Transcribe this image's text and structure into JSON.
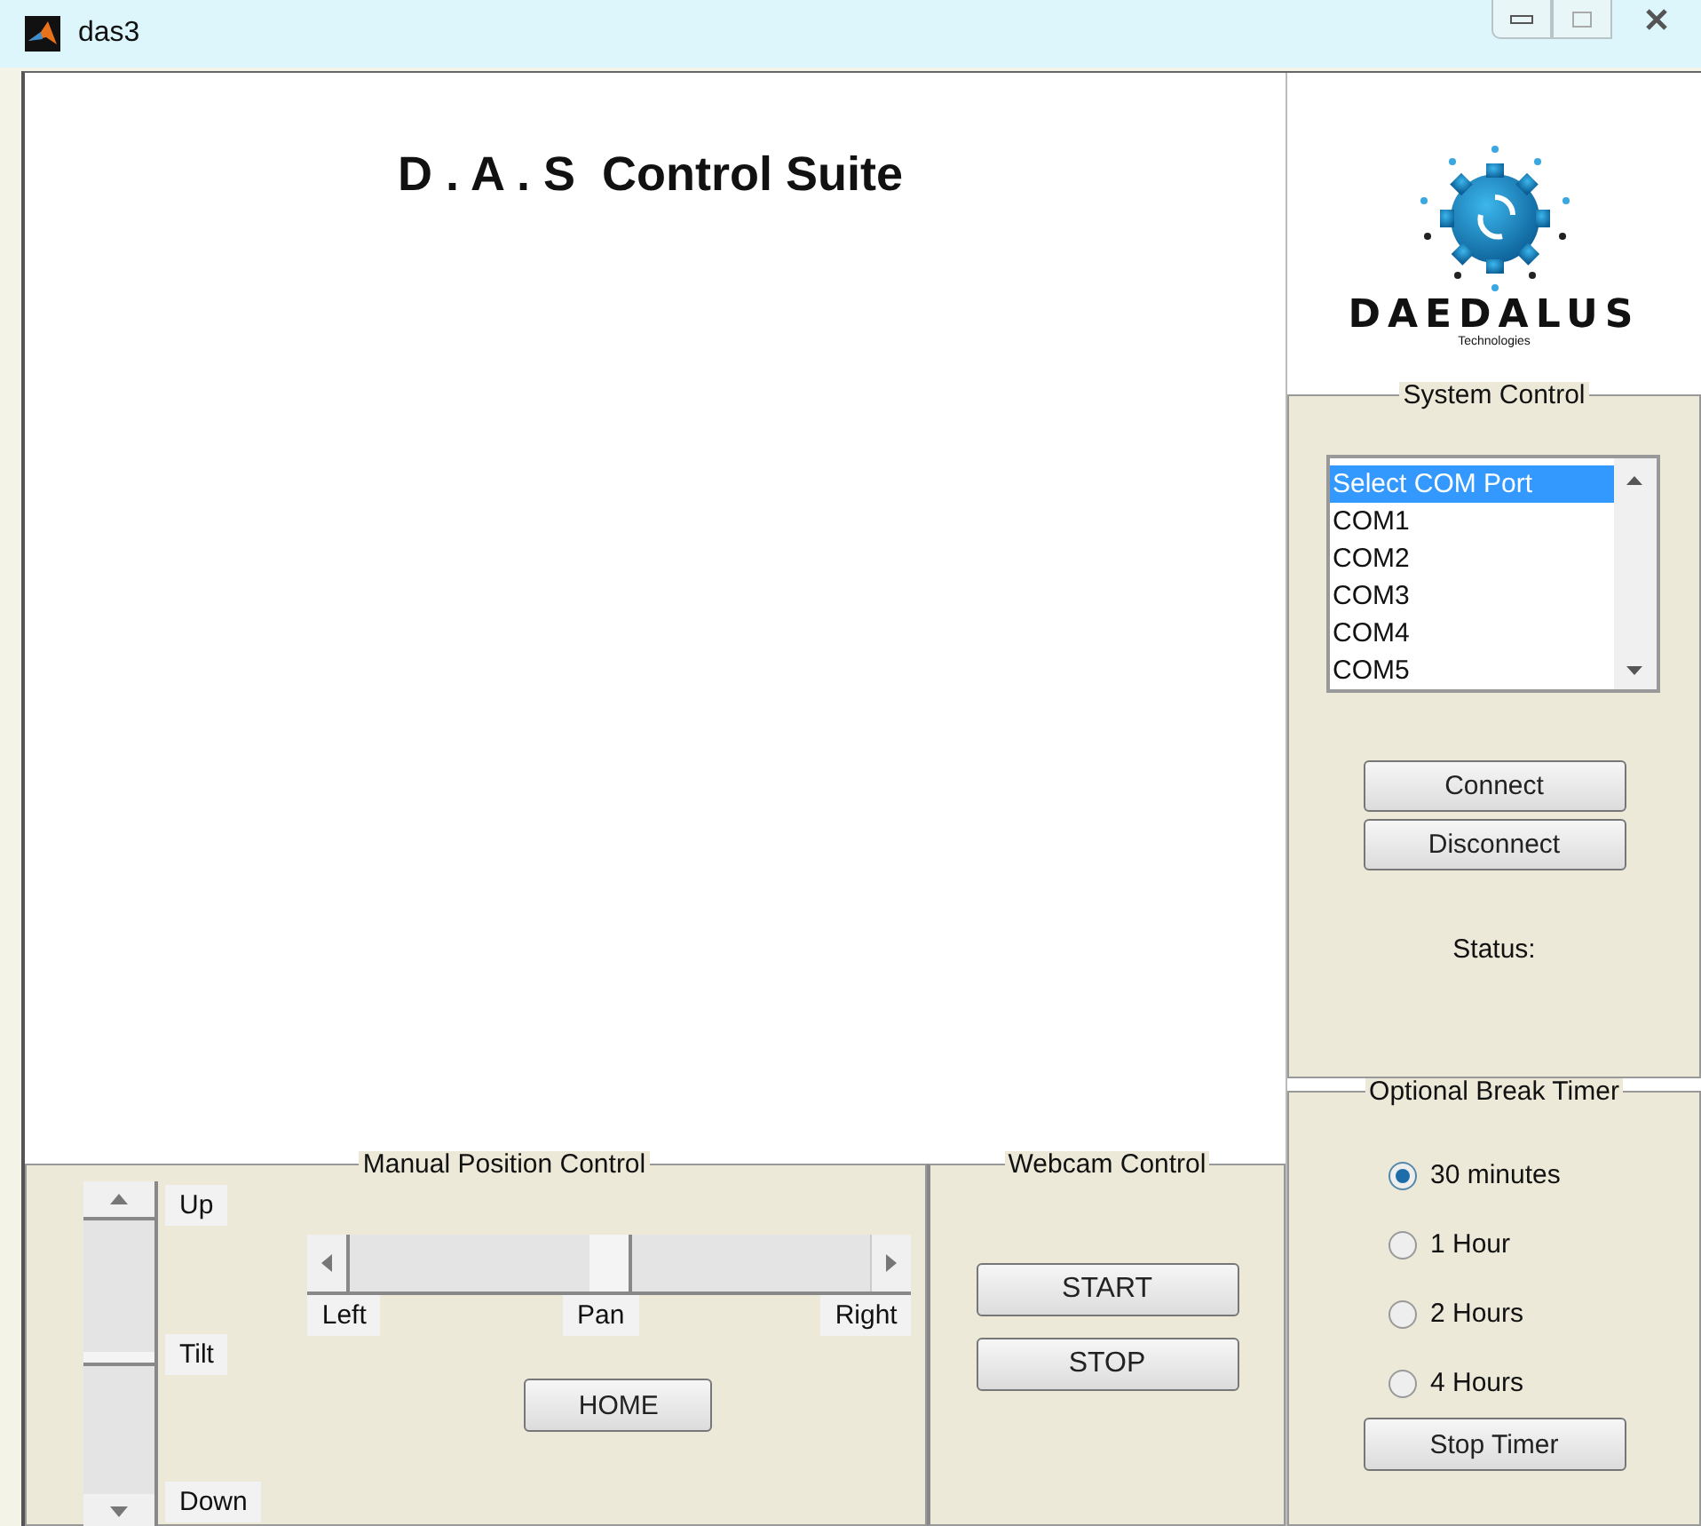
{
  "window": {
    "title": "das3"
  },
  "heading": "D . A . S  Control Suite",
  "logo": {
    "name": "DAEDALUS",
    "tagline": "Technologies"
  },
  "system_control": {
    "title": "System Control",
    "ports": [
      {
        "label": "Select COM Port",
        "selected": true
      },
      {
        "label": "COM1",
        "selected": false
      },
      {
        "label": "COM2",
        "selected": false
      },
      {
        "label": "COM3",
        "selected": false
      },
      {
        "label": "COM4",
        "selected": false
      },
      {
        "label": "COM5",
        "selected": false
      }
    ],
    "buttons": [
      "Connect",
      "Disconnect"
    ],
    "status_label": "Status:"
  },
  "break_timer": {
    "title": "Optional Break Timer",
    "options": [
      {
        "label": "30 minutes",
        "selected": true
      },
      {
        "label": "1 Hour",
        "selected": false
      },
      {
        "label": "2 Hours",
        "selected": false
      },
      {
        "label": "4 Hours",
        "selected": false
      }
    ],
    "button": "Stop Timer"
  },
  "manual_position": {
    "title": "Manual Position Control",
    "tilt": {
      "level": 0.5,
      "up": "Up",
      "label": "Tilt",
      "down": "Down"
    },
    "pan": {
      "level": 0.5,
      "left": "Left",
      "label": "Pan",
      "right": "Right"
    },
    "home_button": "HOME"
  },
  "webcam": {
    "title": "Webcam Control",
    "buttons": [
      "START",
      "STOP"
    ]
  }
}
